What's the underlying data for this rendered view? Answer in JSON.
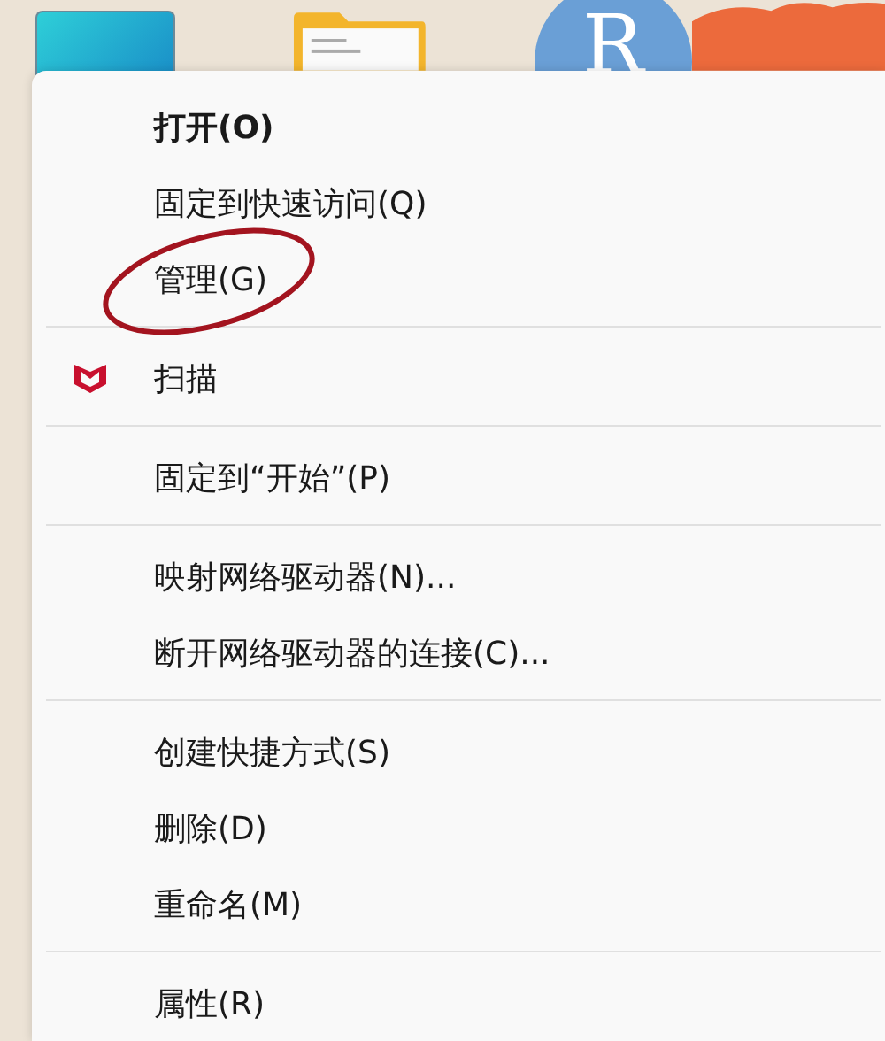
{
  "desktop": {
    "avatar_letter": "R"
  },
  "context_menu": {
    "groups": [
      {
        "items": [
          {
            "label": "打开(O)",
            "default": true,
            "kind": "plain"
          },
          {
            "label": "固定到快速访问(Q)",
            "default": false,
            "kind": "plain"
          },
          {
            "label": "管理(G)",
            "default": false,
            "kind": "plain",
            "circled": true
          }
        ]
      },
      {
        "items": [
          {
            "label": "扫描",
            "default": false,
            "kind": "scan"
          }
        ]
      },
      {
        "items": [
          {
            "label": "固定到“开始”(P)",
            "default": false,
            "kind": "plain"
          }
        ]
      },
      {
        "items": [
          {
            "label": "映射网络驱动器(N)...",
            "default": false,
            "kind": "plain"
          },
          {
            "label": "断开网络驱动器的连接(C)...",
            "default": false,
            "kind": "plain"
          }
        ]
      },
      {
        "items": [
          {
            "label": "创建快捷方式(S)",
            "default": false,
            "kind": "plain"
          },
          {
            "label": "删除(D)",
            "default": false,
            "kind": "plain"
          },
          {
            "label": "重命名(M)",
            "default": false,
            "kind": "plain"
          }
        ]
      },
      {
        "items": [
          {
            "label": "属性(R)",
            "default": false,
            "kind": "plain"
          }
        ]
      }
    ]
  }
}
